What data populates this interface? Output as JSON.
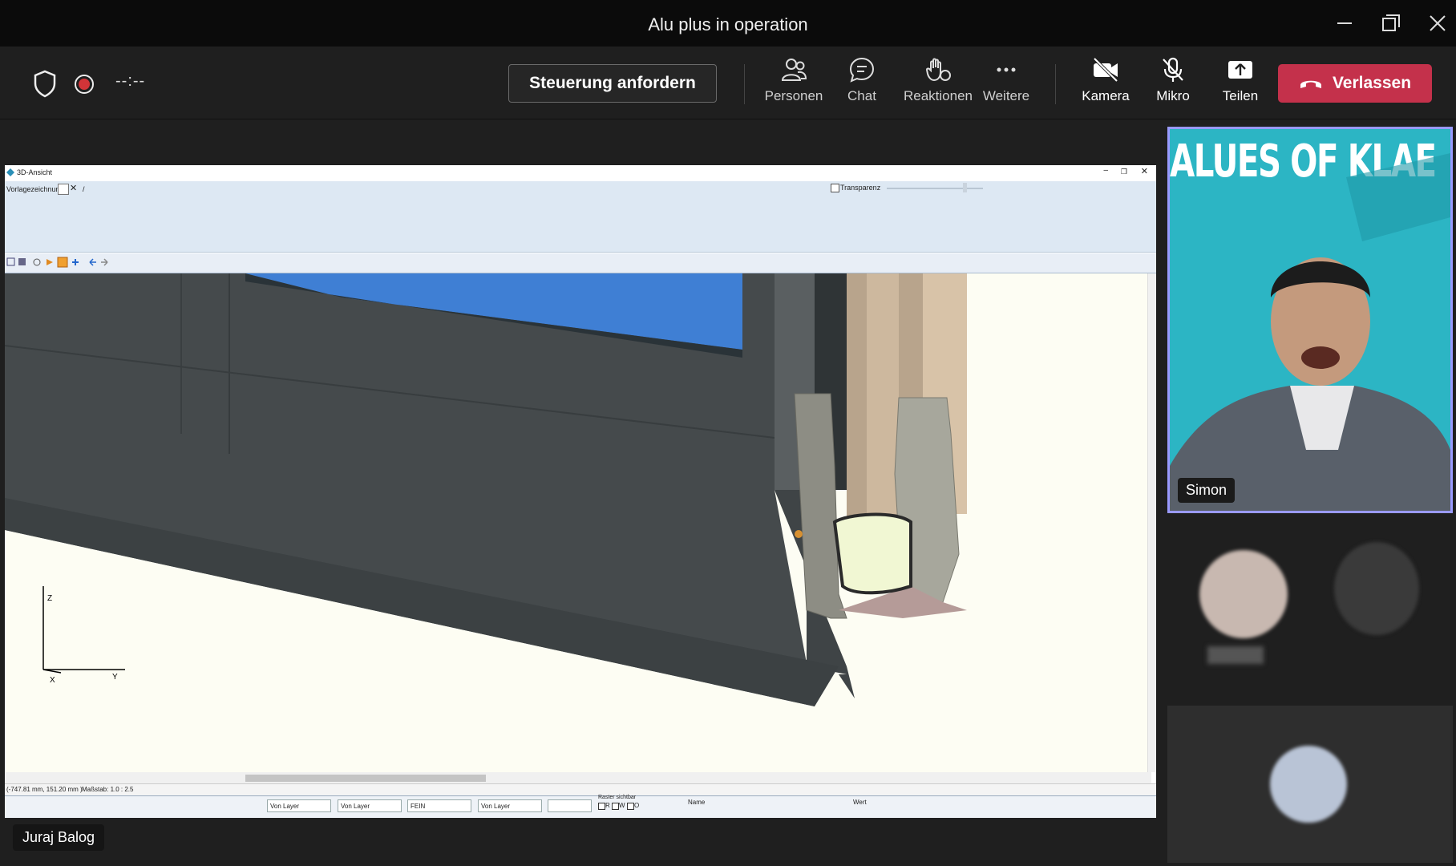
{
  "window": {
    "title": "Alu plus in operation"
  },
  "toolbar": {
    "timer": "--:--",
    "request_control": "Steuerung anfordern",
    "people": "Personen",
    "chat": "Chat",
    "reactions": "Reaktionen",
    "more": "Weitere",
    "camera": "Kamera",
    "mic": "Mikro",
    "share": "Teilen",
    "leave": "Verlassen"
  },
  "cad": {
    "window_title": "3D-Ansicht",
    "template_label": "Vorlagezeichnung:",
    "template_value": "/",
    "transparency": "Transparenz",
    "axis_z": "Z",
    "axis_x": "X",
    "axis_y": "Y",
    "coords": "(-747.81 mm, 151.20 mm )",
    "scale": "Maßstab: 1.0 : 2.5",
    "combo1": "Von Layer",
    "combo2": "Von Layer",
    "combo3": "FEIN",
    "combo4": "Von Layer",
    "raster_label": "Raster sichtbar",
    "raster_r": "R",
    "raster_w": "W",
    "raster_o": "O",
    "prop_name": "Name",
    "prop_value": "Wert"
  },
  "presenter": {
    "name": "Juraj Balog"
  },
  "participants": {
    "video_name": "Simon",
    "banner": "ALUES OF KLAE"
  },
  "colors": {
    "leave": "#c4314b",
    "speaking_border": "#9a9aff",
    "banner_bg": "#2cb5c4"
  }
}
